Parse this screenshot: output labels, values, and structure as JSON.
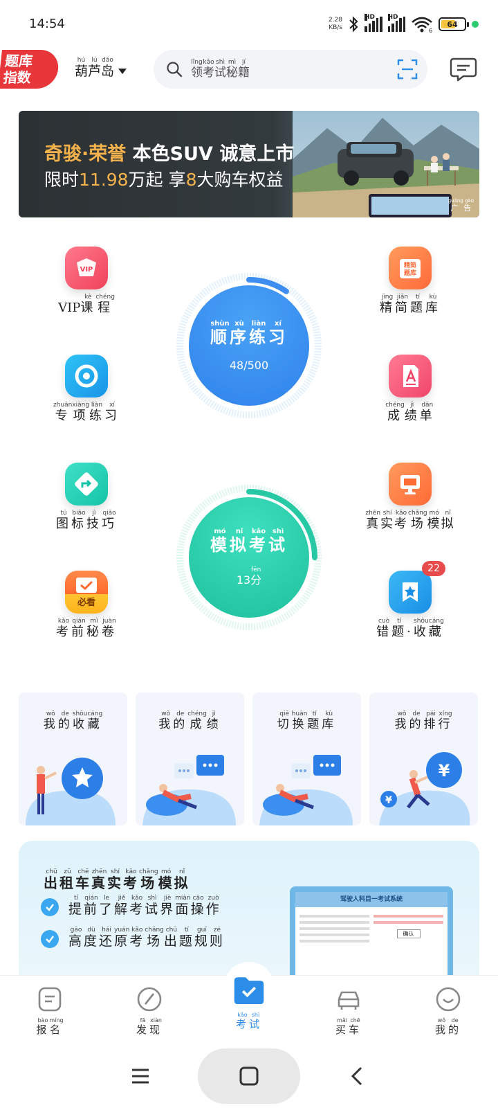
{
  "status_bar": {
    "time": "14:54",
    "net_speed_value": "2.28",
    "net_speed_unit": "KB/s",
    "hd1": "HD",
    "hd2": "HD",
    "wifi_sub": "6",
    "battery": "64"
  },
  "header": {
    "logo_line1": "题库",
    "logo_line2": "指数",
    "city": {
      "chars": [
        {
          "c": "葫",
          "p": "hú"
        },
        {
          "c": "芦",
          "p": "lú"
        },
        {
          "c": "岛",
          "p": "dǎo"
        }
      ]
    },
    "search_placeholder": [
      {
        "c": "领",
        "p": "lǐng"
      },
      {
        "c": "考",
        "p": "kǎo"
      },
      {
        "c": "试",
        "p": "shì"
      },
      {
        "c": "秘",
        "p": "mì"
      },
      {
        "c": "籍",
        "p": "jí"
      }
    ]
  },
  "banner": {
    "brand": "奇骏·荣誉",
    "headline": "本色SUV 诚意上市",
    "line2_prefix": "限时",
    "price": "11.98",
    "line2_mid": "万起",
    "line2_suffix": "享",
    "benefit_count": "8",
    "benefit_text": "大购车权益",
    "ad_label": "广告",
    "ad_pinyin": "guǎng gào"
  },
  "features": {
    "vip": {
      "prefix": "VIP",
      "chars": [
        {
          "c": "课",
          "p": "kè"
        },
        {
          "c": "程",
          "p": "chéng"
        }
      ],
      "icon_text": "VIP"
    },
    "jingjian": {
      "chars": [
        {
          "c": "精",
          "p": "jīng"
        },
        {
          "c": "简",
          "p": "jiǎn"
        },
        {
          "c": "题",
          "p": "tí"
        },
        {
          "c": "库",
          "p": "kù"
        }
      ],
      "icon_text": "精简\n题库"
    },
    "zhuanxiang": {
      "chars": [
        {
          "c": "专",
          "p": "zhuān"
        },
        {
          "c": "项",
          "p": "xiàng"
        },
        {
          "c": "练",
          "p": "liàn"
        },
        {
          "c": "习",
          "p": "xí"
        }
      ]
    },
    "chengji": {
      "chars": [
        {
          "c": "成",
          "p": "chéng"
        },
        {
          "c": "绩",
          "p": "jì"
        },
        {
          "c": "单",
          "p": "dān"
        }
      ]
    },
    "tubiao": {
      "chars": [
        {
          "c": "图",
          "p": "tú"
        },
        {
          "c": "标",
          "p": "biāo"
        },
        {
          "c": "技",
          "p": "jì"
        },
        {
          "c": "巧",
          "p": "qiǎo"
        }
      ]
    },
    "zhenshi": {
      "chars": [
        {
          "c": "真",
          "p": "zhēn"
        },
        {
          "c": "实",
          "p": "shí"
        },
        {
          "c": "考",
          "p": "kǎo"
        },
        {
          "c": "场",
          "p": "chǎng"
        },
        {
          "c": "模",
          "p": "mó"
        },
        {
          "c": "拟",
          "p": "nǐ"
        }
      ]
    },
    "kaoqian": {
      "chars": [
        {
          "c": "考",
          "p": "kǎo"
        },
        {
          "c": "前",
          "p": "qián"
        },
        {
          "c": "秘",
          "p": "mì"
        },
        {
          "c": "卷",
          "p": "juàn"
        }
      ],
      "icon_text": "必看"
    },
    "cuoti": {
      "chars": [
        {
          "c": "错",
          "p": "cuò"
        },
        {
          "c": "题",
          "p": "tí"
        },
        {
          "c": "·",
          "p": ""
        },
        {
          "c": "收",
          "p": "shōu"
        },
        {
          "c": "藏",
          "p": "cáng"
        }
      ],
      "badge": "22"
    }
  },
  "circles": {
    "order": {
      "chars": [
        {
          "c": "顺",
          "p": "shùn"
        },
        {
          "c": "序",
          "p": "xù"
        },
        {
          "c": "练",
          "p": "liàn"
        },
        {
          "c": "习",
          "p": "xí"
        }
      ],
      "progress": "48/500",
      "done": 48,
      "total": 500
    },
    "exam": {
      "chars": [
        {
          "c": "模",
          "p": "mó"
        },
        {
          "c": "拟",
          "p": "nǐ"
        },
        {
          "c": "考",
          "p": "kǎo"
        },
        {
          "c": "试",
          "p": "shì"
        }
      ],
      "score": "13",
      "unit": {
        "c": "分",
        "p": "fēn"
      },
      "score_fraction": 0.13
    }
  },
  "cards": [
    {
      "chars": [
        {
          "c": "我",
          "p": "wǒ"
        },
        {
          "c": "的",
          "p": "de"
        },
        {
          "c": "收",
          "p": "shōu"
        },
        {
          "c": "藏",
          "p": "cáng"
        }
      ]
    },
    {
      "chars": [
        {
          "c": "我",
          "p": "wǒ"
        },
        {
          "c": "的",
          "p": "de"
        },
        {
          "c": "成",
          "p": "chéng"
        },
        {
          "c": "绩",
          "p": "jì"
        }
      ]
    },
    {
      "chars": [
        {
          "c": "切",
          "p": "qiē"
        },
        {
          "c": "换",
          "p": "huàn"
        },
        {
          "c": "题",
          "p": "tí"
        },
        {
          "c": "库",
          "p": "kù"
        }
      ]
    },
    {
      "chars": [
        {
          "c": "我",
          "p": "wǒ"
        },
        {
          "c": "的",
          "p": "de"
        },
        {
          "c": "排",
          "p": "pái"
        },
        {
          "c": "行",
          "p": "xíng"
        }
      ]
    }
  ],
  "promo": {
    "title": [
      {
        "c": "出",
        "p": "chū"
      },
      {
        "c": "租",
        "p": "zū"
      },
      {
        "c": "车",
        "p": "chē"
      },
      {
        "c": "真",
        "p": "zhēn"
      },
      {
        "c": "实",
        "p": "shí"
      },
      {
        "c": "考",
        "p": "kǎo"
      },
      {
        "c": "场",
        "p": "chǎng"
      },
      {
        "c": "模",
        "p": "mó"
      },
      {
        "c": "拟",
        "p": "nǐ"
      }
    ],
    "items": [
      [
        {
          "c": "提",
          "p": "tí"
        },
        {
          "c": "前",
          "p": "qián"
        },
        {
          "c": "了",
          "p": "le"
        },
        {
          "c": "解",
          "p": "jiě"
        },
        {
          "c": "考",
          "p": "kǎo"
        },
        {
          "c": "试",
          "p": "shì"
        },
        {
          "c": "界",
          "p": "jiè"
        },
        {
          "c": "面",
          "p": "miàn"
        },
        {
          "c": "操",
          "p": "cāo"
        },
        {
          "c": "作",
          "p": "zuò"
        }
      ],
      [
        {
          "c": "高",
          "p": "gāo"
        },
        {
          "c": "度",
          "p": "dù"
        },
        {
          "c": "还",
          "p": "hái"
        },
        {
          "c": "原",
          "p": "yuán"
        },
        {
          "c": "考",
          "p": "kǎo"
        },
        {
          "c": "场",
          "p": "chǎng"
        },
        {
          "c": "出",
          "p": "chū"
        },
        {
          "c": "题",
          "p": "tí"
        },
        {
          "c": "规",
          "p": "guī"
        },
        {
          "c": "则",
          "p": "zé"
        }
      ]
    ],
    "screen_title": "驾驶人科目一考试系统",
    "screen_button": "确认"
  },
  "tabbar": [
    {
      "chars": [
        {
          "c": "报",
          "p": "bào"
        },
        {
          "c": "名",
          "p": "míng"
        }
      ],
      "icon": "document-icon",
      "active": false
    },
    {
      "chars": [
        {
          "c": "发",
          "p": "fā"
        },
        {
          "c": "现",
          "p": "xiàn"
        }
      ],
      "icon": "compass-icon",
      "active": false
    },
    {
      "chars": [
        {
          "c": "考",
          "p": "kǎo"
        },
        {
          "c": "试",
          "p": "shì"
        }
      ],
      "icon": "folder-check-icon",
      "active": true
    },
    {
      "chars": [
        {
          "c": "买",
          "p": "mǎi"
        },
        {
          "c": "车",
          "p": "chē"
        }
      ],
      "icon": "car-icon",
      "active": false
    },
    {
      "chars": [
        {
          "c": "我",
          "p": "wǒ"
        },
        {
          "c": "的",
          "p": "de"
        }
      ],
      "icon": "smile-icon",
      "active": false
    }
  ],
  "colors": {
    "accent": "#2b8de8",
    "order_circle": "#3d8ef0",
    "exam_circle": "#27c9a5",
    "badge": "#e84b4b",
    "banner_highlight": "#f4b24c"
  }
}
